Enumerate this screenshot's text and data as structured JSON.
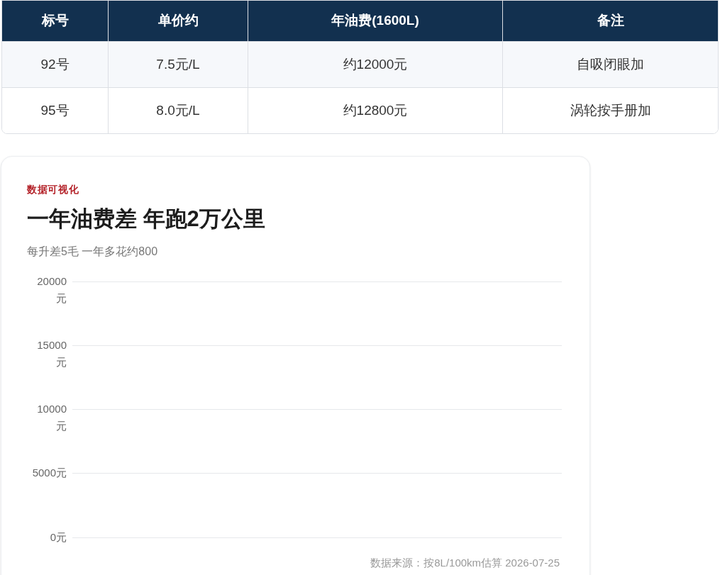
{
  "table": {
    "columns": [
      "标号",
      "单价约",
      "年油费(1600L)",
      "备注"
    ],
    "rows": [
      [
        "92号",
        "7.5元/L",
        "约12000元",
        "自吸闭眼加"
      ],
      [
        "95号",
        "8.0元/L",
        "约12800元",
        "涡轮按手册加"
      ]
    ]
  },
  "chart_card": {
    "eyebrow": "数据可视化",
    "title": "一年油费差 年跑2万公里",
    "subtitle": "每升差5毛 一年多花约800",
    "y_axis_labels": [
      "20000元",
      "15000元",
      "10000元",
      "5000元",
      "0元"
    ],
    "source": "数据来源：按8L/100km估算 2026-07-25"
  }
}
